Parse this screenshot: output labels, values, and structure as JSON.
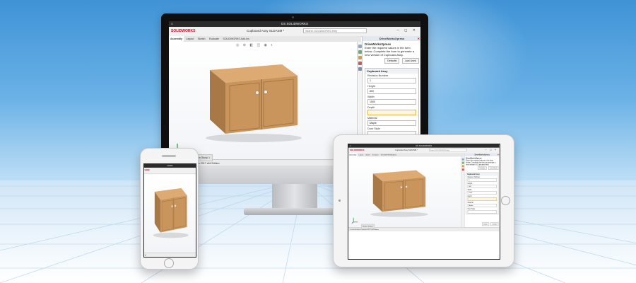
{
  "app": {
    "window_title": "DS SOLIDWORKS",
    "menu_glyph": "≡",
    "logo_text": "SOLIDWORKS",
    "document_title": "Cupboard Assy SLDASM *",
    "search_placeholder": "Search SOLIDWORKS Help",
    "window_controls": "─ ◻ ✕",
    "tabs": [
      "Assembly",
      "Layout",
      "Sketch",
      "Evaluate",
      "SOLIDWORKS Add-Ins"
    ],
    "statusbar": {
      "text": "SOLIDWORKS Premium 2017 x64 Edition",
      "motion_tab": "Motion Study 1",
      "model_tab": "Model",
      "right_text": "Under Defined  Editing Assembly  Custom"
    }
  },
  "panel": {
    "title": "DriveWorksXpress",
    "close_glyph": "✕",
    "intro": "Enter the required values in the form below. Complete the form to generate a new version of Cupboard Assy.",
    "buttons": [
      "Defaults",
      "Last Used"
    ],
    "section_title": "Cupboard Assy",
    "fields": [
      {
        "label": "Revision Number",
        "value": "1"
      },
      {
        "label": "Height",
        "value": "800"
      },
      {
        "label": "Width",
        "value": "1500"
      },
      {
        "label": "Depth",
        "value": ""
      },
      {
        "label": "Material",
        "value": "Maple"
      },
      {
        "label": "Door Style",
        "value": ""
      }
    ],
    "bottom_buttons": [
      "Close",
      "Create"
    ]
  },
  "colors": {
    "cabinet_front": "#c9955c",
    "cabinet_side": "#a87847",
    "cabinet_top": "#dcaa72",
    "accent_red": "#c8102e"
  }
}
